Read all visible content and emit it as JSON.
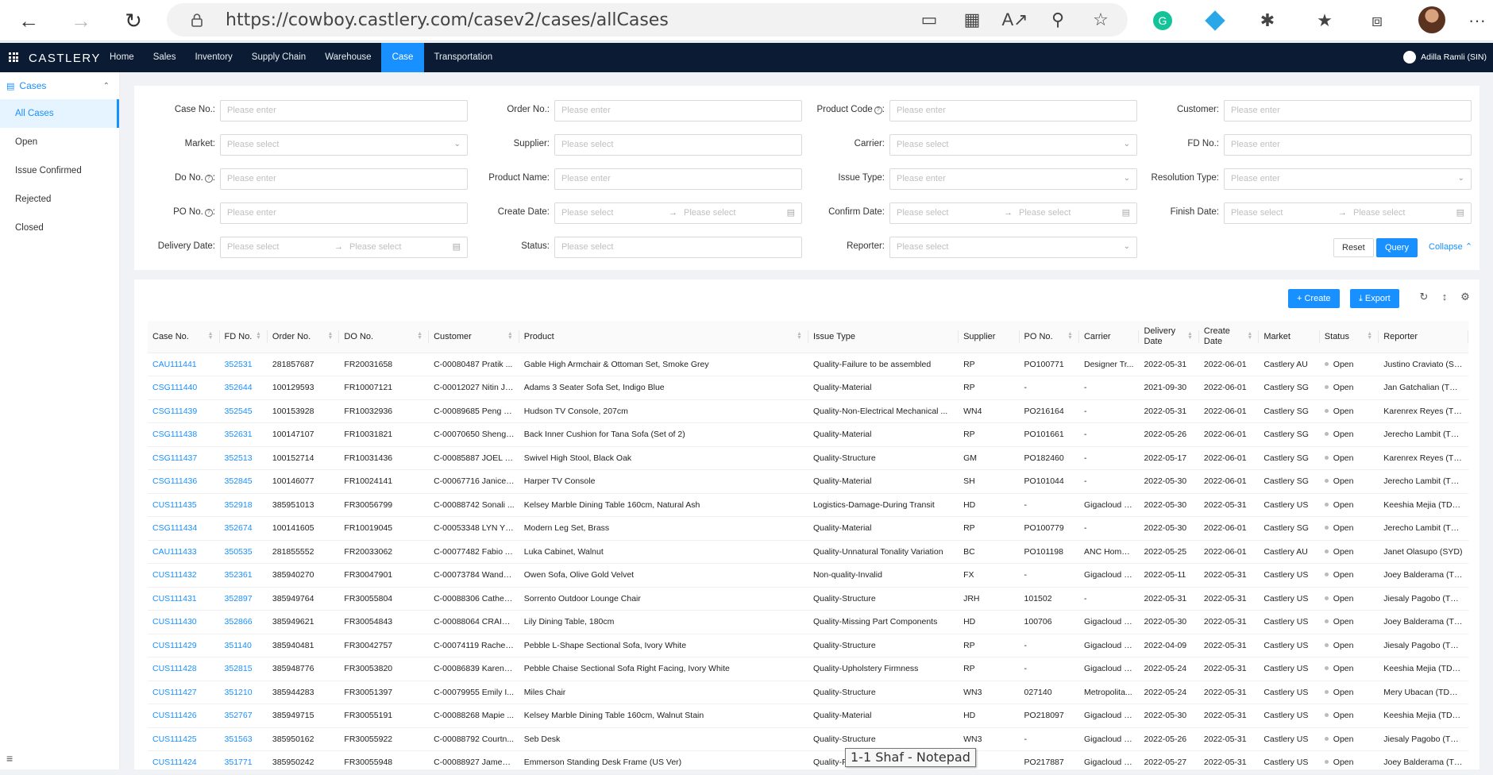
{
  "browser": {
    "url": "https://cowboy.castlery.com/casev2/cases/allCases",
    "more_label": "···"
  },
  "app": {
    "brand": "CASTLERY",
    "nav": [
      {
        "label": "Home"
      },
      {
        "label": "Sales"
      },
      {
        "label": "Inventory"
      },
      {
        "label": "Supply Chain"
      },
      {
        "label": "Warehouse"
      },
      {
        "label": "Case"
      },
      {
        "label": "Transportation"
      }
    ],
    "active_nav": "Case",
    "user": "Adilla Ramli (SIN)"
  },
  "sidebar": {
    "section": "Cases",
    "items": [
      {
        "label": "All Cases"
      },
      {
        "label": "Open"
      },
      {
        "label": "Issue Confirmed"
      },
      {
        "label": "Rejected"
      },
      {
        "label": "Closed"
      }
    ],
    "collapse_glyph": "≡"
  },
  "filters": {
    "case_no": {
      "label": "Case No.:",
      "placeholder": "Please enter"
    },
    "order_no": {
      "label": "Order No.:",
      "placeholder": "Please enter"
    },
    "product_code": {
      "label": "Product Code",
      "placeholder": "Please enter"
    },
    "customer": {
      "label": "Customer:",
      "placeholder": "Please enter"
    },
    "market": {
      "label": "Market:",
      "placeholder": "Please select"
    },
    "supplier": {
      "label": "Supplier:",
      "placeholder": "Please select"
    },
    "carrier": {
      "label": "Carrier:",
      "placeholder": "Please select"
    },
    "fd_no": {
      "label": "FD No.:",
      "placeholder": "Please enter"
    },
    "do_no": {
      "label": "Do No.",
      "placeholder": "Please enter"
    },
    "product_name": {
      "label": "Product Name:",
      "placeholder": "Please enter"
    },
    "issue_type": {
      "label": "Issue Type:",
      "placeholder": "Please enter"
    },
    "resolution_type": {
      "label": "Resolution Type:",
      "placeholder": "Please enter"
    },
    "po_no": {
      "label": "PO No.",
      "placeholder": "Please enter"
    },
    "create_date": {
      "label": "Create Date:",
      "start": "Please select",
      "end": "Please select"
    },
    "confirm_date": {
      "label": "Confirm Date:",
      "start": "Please select",
      "end": "Please select"
    },
    "finish_date": {
      "label": "Finish Date:",
      "start": "Please select",
      "end": "Please select"
    },
    "delivery_date": {
      "label": "Delivery Date:",
      "start": "Please select",
      "end": "Please select"
    },
    "status": {
      "label": "Status:",
      "placeholder": "Please select"
    },
    "reporter": {
      "label": "Reporter:",
      "placeholder": "Please select"
    },
    "reset_label": "Reset",
    "query_label": "Query",
    "collapse_label": "Collapse"
  },
  "toolbar": {
    "create_label": "Create",
    "export_label": "Export"
  },
  "table": {
    "columns": [
      "Case No.",
      "FD No.",
      "Order No.",
      "DO No.",
      "Customer",
      "Product",
      "Issue Type",
      "Supplier",
      "PO No.",
      "Carrier",
      "Delivery Date",
      "Create Date",
      "Market",
      "Status",
      "Reporter"
    ],
    "rows": [
      [
        "CAU111441",
        "352531",
        "281857687",
        "FR20031658",
        "C-00080487 Pratik ...",
        "Gable High Armchair & Ottoman Set, Smoke Grey",
        "Quality-Failure to be assembled",
        "RP",
        "PO100771",
        "Designer Tr...",
        "2022-05-31",
        "2022-06-01",
        "Castlery AU",
        "Open",
        "Justino Craviato (SY..."
      ],
      [
        "CSG111440",
        "352644",
        "100129593",
        "FR10007121",
        "C-00012027 Nitin Ja...",
        "Adams 3 Seater Sofa Set, Indigo Blue",
        "Quality-Material",
        "RP",
        "-",
        "-",
        "2021-09-30",
        "2022-06-01",
        "Castlery SG",
        "Open",
        "Jan Gatchalian (TDC..."
      ],
      [
        "CSG111439",
        "352545",
        "100153928",
        "FR10032936",
        "C-00089685 Peng P...",
        "Hudson TV Console, 207cm",
        "Quality-Non-Electrical Mechanical ...",
        "WN4",
        "PO216164",
        "-",
        "2022-05-31",
        "2022-06-01",
        "Castlery SG",
        "Open",
        "Karenrex Reyes (Tdcx)"
      ],
      [
        "CSG111438",
        "352631",
        "100147107",
        "FR10031821",
        "C-00070650 Sheng ...",
        "Back Inner Cushion for Tana Sofa (Set of 2)",
        "Quality-Material",
        "RP",
        "PO101661",
        "-",
        "2022-05-26",
        "2022-06-01",
        "Castlery SG",
        "Open",
        "Jerecho Lambit (TD..."
      ],
      [
        "CSG111437",
        "352513",
        "100152714",
        "FR10031436",
        "C-00085887 JOEL P...",
        "Swivel High Stool, Black Oak",
        "Quality-Structure",
        "GM",
        "PO182460",
        "-",
        "2022-05-17",
        "2022-06-01",
        "Castlery SG",
        "Open",
        "Karenrex Reyes (Tdcx)"
      ],
      [
        "CSG111436",
        "352845",
        "100146077",
        "FR10024141",
        "C-00067716 Janice ...",
        "Harper TV Console",
        "Quality-Material",
        "SH",
        "PO101044",
        "-",
        "2022-05-30",
        "2022-06-01",
        "Castlery SG",
        "Open",
        "Jerecho Lambit (TD..."
      ],
      [
        "CUS111435",
        "352918",
        "385951013",
        "FR30056799",
        "C-00088742 Sonali ...",
        "Kelsey Marble Dining Table 160cm, Natural Ash",
        "Logistics-Damage-During Transit",
        "HD",
        "-",
        "Gigacloud L...",
        "2022-05-30",
        "2022-05-31",
        "Castlery US",
        "Open",
        "Keeshia Mejia (TDCX)"
      ],
      [
        "CSG111434",
        "352674",
        "100141605",
        "FR10019045",
        "C-00053348 LYN YEO",
        "Modern Leg Set, Brass",
        "Quality-Material",
        "RP",
        "PO100779",
        "-",
        "2022-05-30",
        "2022-06-01",
        "Castlery SG",
        "Open",
        "Jerecho Lambit (TD..."
      ],
      [
        "CAU111433",
        "350535",
        "281855552",
        "FR20033062",
        "C-00077482 Fabio A...",
        "Luka Cabinet, Walnut",
        "Quality-Unnatural Tonality Variation",
        "BC",
        "PO101198",
        "ANC Home ...",
        "2022-05-25",
        "2022-06-01",
        "Castlery AU",
        "Open",
        "Janet Olasupo (SYD)"
      ],
      [
        "CUS111432",
        "352361",
        "385940270",
        "FR30047901",
        "C-00073784 Wanda...",
        "Owen Sofa, Olive Gold Velvet",
        "Non-quality-Invalid",
        "FX",
        "-",
        "Gigacloud L...",
        "2022-05-11",
        "2022-05-31",
        "Castlery US",
        "Open",
        "Joey Balderama (TD..."
      ],
      [
        "CUS111431",
        "352897",
        "385949764",
        "FR30055804",
        "C-00088306 Catheri...",
        "Sorrento Outdoor Lounge Chair",
        "Quality-Structure",
        "JRH",
        "101502",
        "-",
        "2022-05-31",
        "2022-05-31",
        "Castlery US",
        "Open",
        "Jiesaly Pagobo (TDC..."
      ],
      [
        "CUS111430",
        "352866",
        "385949621",
        "FR30054843",
        "C-00088064 CRAIG ...",
        "Lily Dining Table, 180cm",
        "Quality-Missing Part Components",
        "HD",
        "100706",
        "Gigacloud L...",
        "2022-05-30",
        "2022-05-31",
        "Castlery US",
        "Open",
        "Joey Balderama (TD..."
      ],
      [
        "CUS111429",
        "351140",
        "385940481",
        "FR30042757",
        "C-00074119 Rachel ...",
        "Pebble L-Shape Sectional Sofa, Ivory White",
        "Quality-Structure",
        "RP",
        "-",
        "Gigacloud L...",
        "2022-04-09",
        "2022-05-31",
        "Castlery US",
        "Open",
        "Jiesaly Pagobo (TDC..."
      ],
      [
        "CUS111428",
        "352815",
        "385948776",
        "FR30053820",
        "C-00086839 Karen Yu",
        "Pebble Chaise Sectional Sofa Right Facing, Ivory White",
        "Quality-Upholstery Firmness",
        "RP",
        "-",
        "Gigacloud L...",
        "2022-05-24",
        "2022-05-31",
        "Castlery US",
        "Open",
        "Keeshia Mejia (TDCX)"
      ],
      [
        "CUS111427",
        "351210",
        "385944283",
        "FR30051397",
        "C-00079955 Emily I...",
        "Miles Chair",
        "Quality-Structure",
        "WN3",
        "027140",
        "Metropolita...",
        "2022-05-24",
        "2022-05-31",
        "Castlery US",
        "Open",
        "Mery Ubacan (TDCX)"
      ],
      [
        "CUS111426",
        "352767",
        "385949715",
        "FR30055191",
        "C-00088268 Mapie ...",
        "Kelsey Marble Dining Table 160cm, Walnut Stain",
        "Quality-Material",
        "HD",
        "PO218097",
        "Gigacloud L...",
        "2022-05-30",
        "2022-05-31",
        "Castlery US",
        "Open",
        "Keeshia Mejia (TDCX)"
      ],
      [
        "CUS111425",
        "351563",
        "385950162",
        "FR30055922",
        "C-00088792 Courtn...",
        "Seb Desk",
        "Quality-Structure",
        "WN3",
        "-",
        "Gigacloud L...",
        "2022-05-26",
        "2022-05-31",
        "Castlery US",
        "Open",
        "Jiesaly Pagobo (TDC..."
      ],
      [
        "CUS111424",
        "351771",
        "385950242",
        "FR30055948",
        "C-00088927 James ...",
        "Emmerson Standing Desk Frame (US Ver)",
        "Quality-F...",
        "",
        "PO217887",
        "Gigacloud L...",
        "2022-05-27",
        "2022-05-31",
        "Castlery US",
        "Open",
        "Joey Balderama (TD..."
      ]
    ]
  },
  "taskbar_tooltip": "1-1 Shaf - Notepad"
}
